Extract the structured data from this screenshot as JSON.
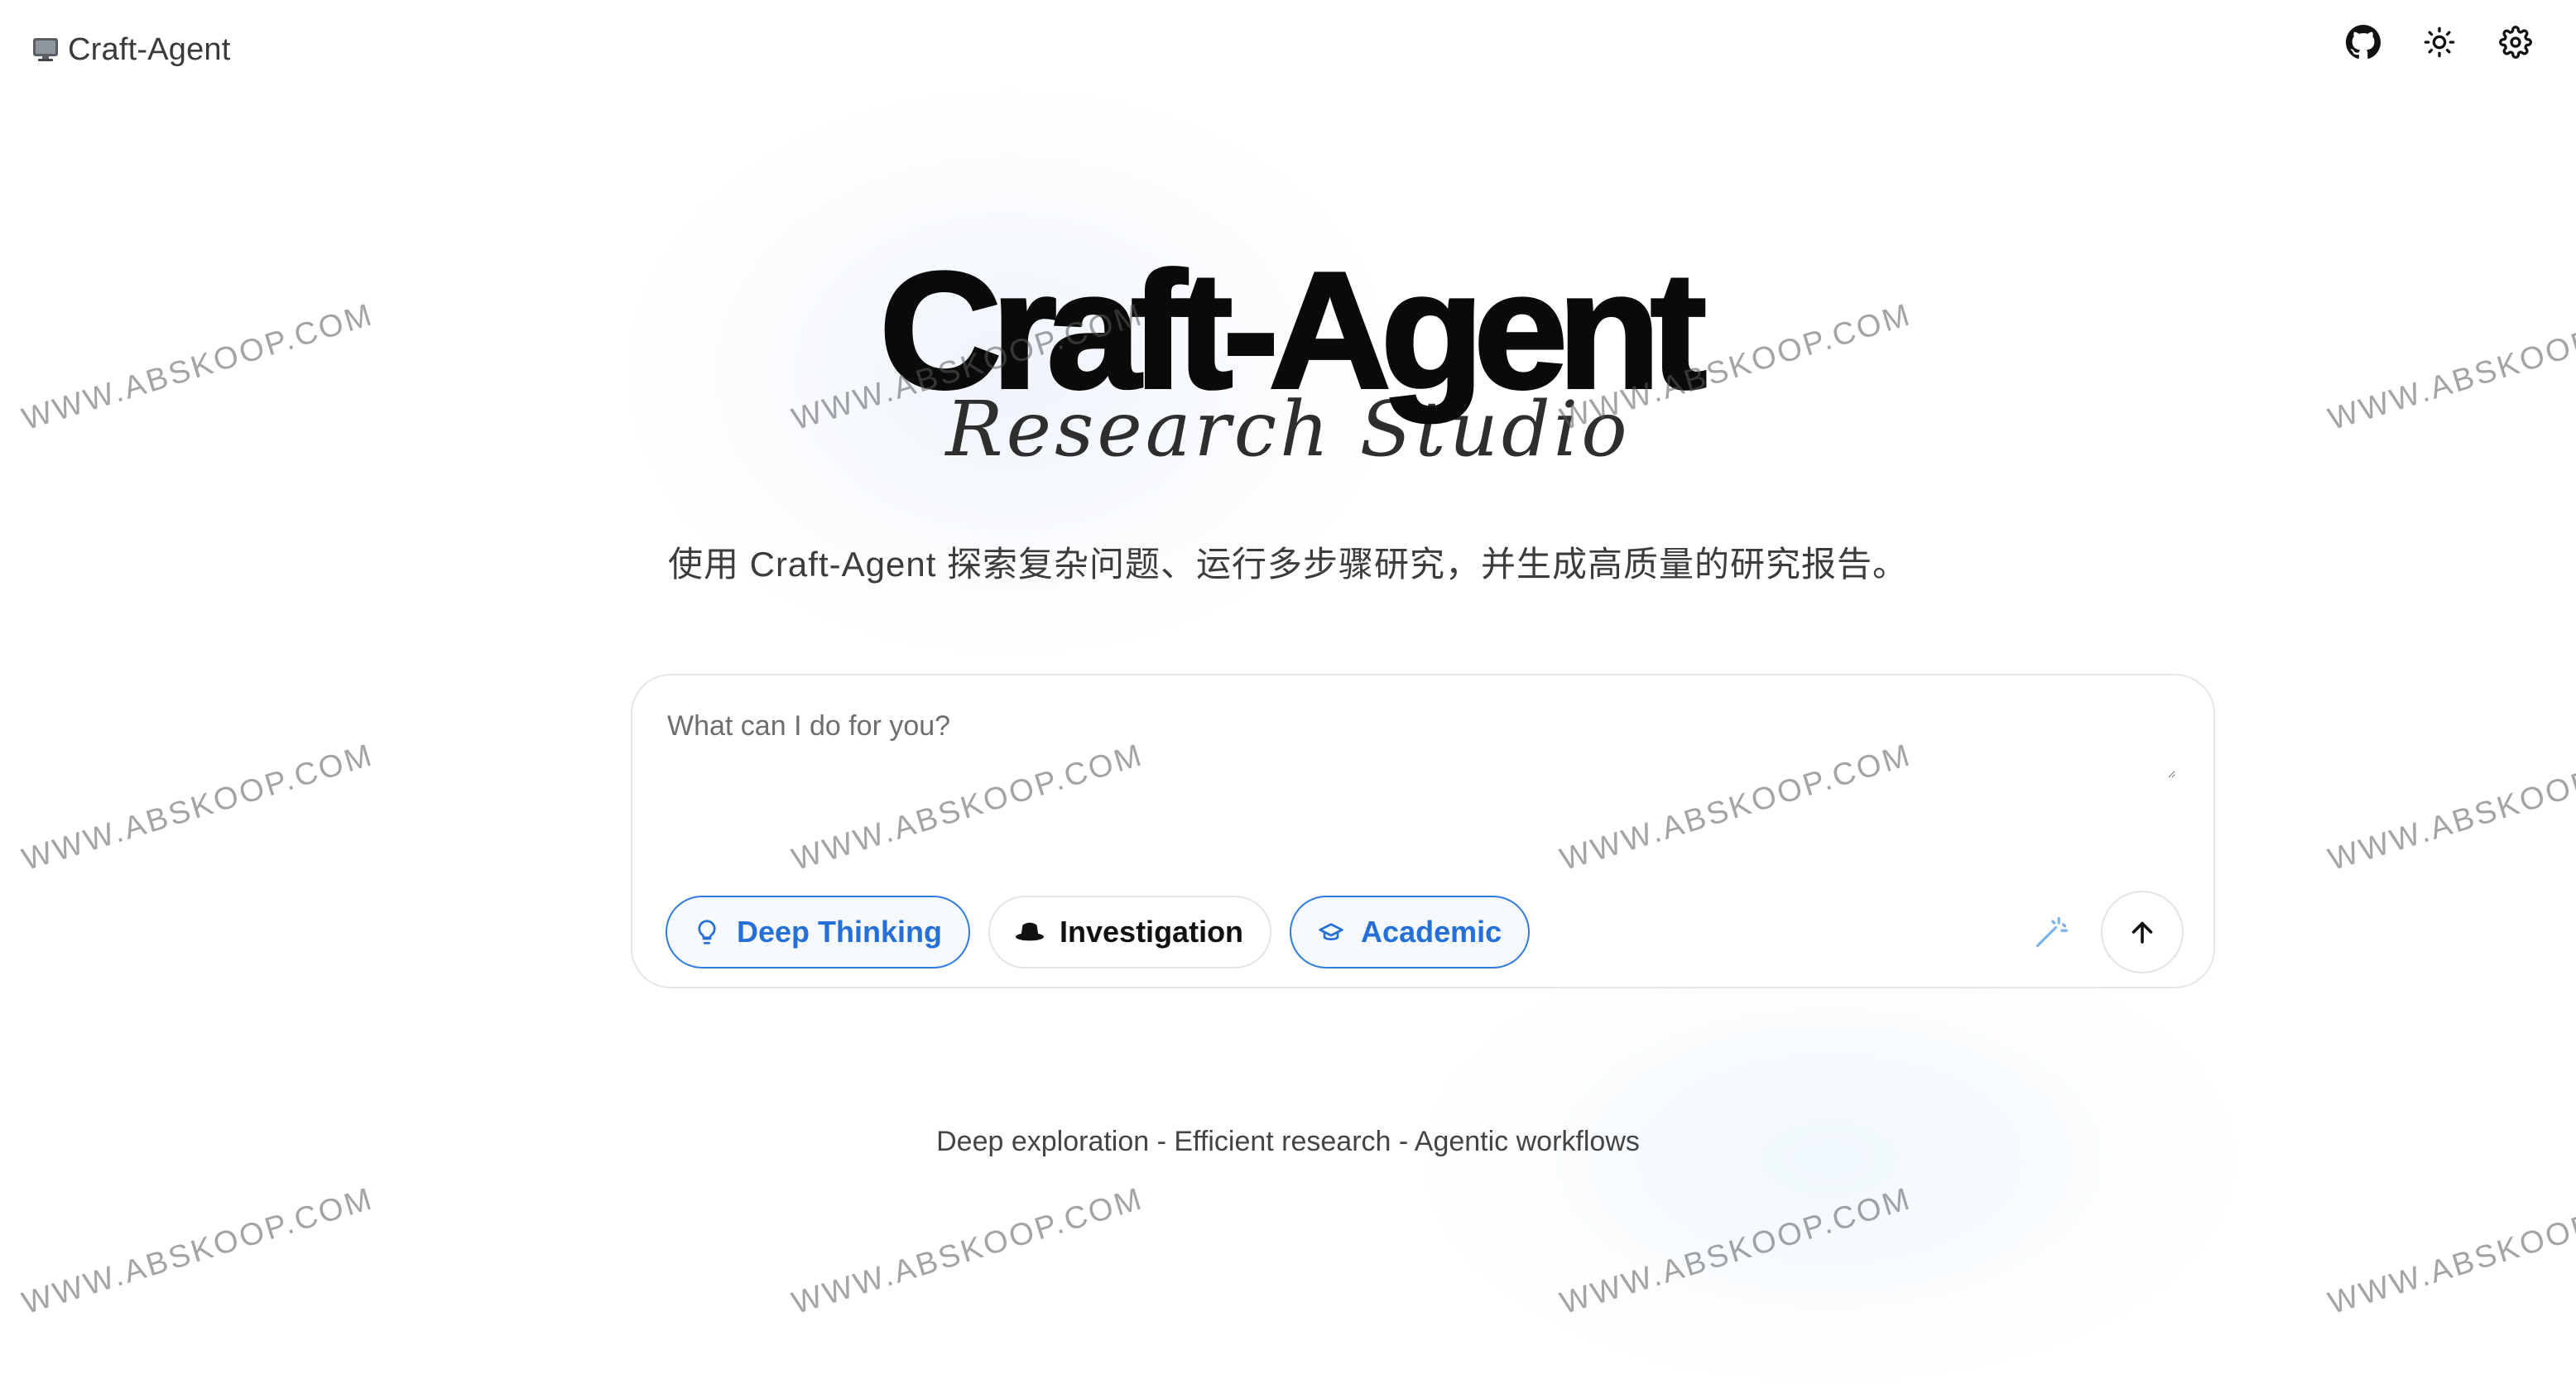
{
  "app": {
    "brand_label": "Craft-Agent",
    "brand_icon": "monitor-icon"
  },
  "topbar": {
    "github_icon": "github-icon",
    "theme_icon": "sun-icon",
    "settings_icon": "gear-icon"
  },
  "hero": {
    "title": "Craft-Agent",
    "subtitle": "Research Studio",
    "description": "使用 Craft-Agent 探索复杂问题、运行多步骤研究，并生成高质量的研究报告。"
  },
  "input": {
    "placeholder": "What can I do for you?",
    "value": ""
  },
  "modes": [
    {
      "label": "Deep Thinking",
      "icon": "lightbulb-icon",
      "active": true
    },
    {
      "label": "Investigation",
      "icon": "detective-hat-icon",
      "active": false
    },
    {
      "label": "Academic",
      "icon": "graduation-cap-icon",
      "active": true
    }
  ],
  "actions": {
    "enhance_icon": "magic-wand-icon",
    "send_icon": "arrow-up-icon"
  },
  "tagline": "Deep exploration - Efficient research - Agentic workflows",
  "watermark": "WWW.ABSKOOP.COM",
  "colors": {
    "accent": "#2f7be0",
    "text": "#111111",
    "muted": "#6e6e6e",
    "border": "#e4e4e4"
  }
}
